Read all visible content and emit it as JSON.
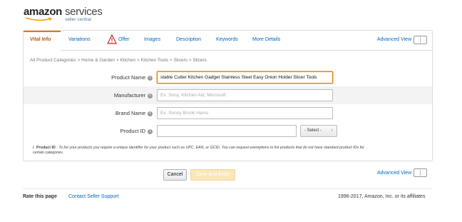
{
  "brand": {
    "name": "amazon",
    "suffix": "services",
    "subtitle": "seller central"
  },
  "tabs": [
    {
      "label": "Vital Info",
      "active": true
    },
    {
      "label": "Variations"
    },
    {
      "label": "Offer",
      "warning": true
    },
    {
      "label": "Images"
    },
    {
      "label": "Description"
    },
    {
      "label": "Keywords"
    },
    {
      "label": "More Details"
    }
  ],
  "advanced_view_label": "Advanced View",
  "breadcrumb": "All Product Categories > Home & Garden > Kitchen > Kitchen Tools > Slicers > Slicers",
  "form": {
    "product_name": {
      "label": "Product Name",
      "value": "stable Cutter Kitchen Gadget Stainless Steel Easy Onion Holder Slicer Tools"
    },
    "manufacturer": {
      "label": "Manufacturer",
      "placeholder": "Ex: Sony, Kitchen Aid, Microsoft"
    },
    "brand_name": {
      "label": "Brand Name",
      "placeholder": "Ex: Sonny Brook Hams"
    },
    "product_id": {
      "label": "Product ID",
      "select": "- Select -"
    }
  },
  "note": {
    "title": "Product ID",
    "text": ": To list your products you require a unique identifier for your product such as UPC, EAN, or GCID. You can request exemptions to list products that do not have standard product IDs for certain categories."
  },
  "buttons": {
    "cancel": "Cancel",
    "save": "Save and finish"
  },
  "footer": {
    "rate": "Rate this page",
    "contact": "Contact Seller Support",
    "copyright": "1996-2017, Amazon, Inc. or its affiliates"
  },
  "colors": {
    "accent": "#e47911",
    "link": "#0066c0",
    "active_tab": "#c45500"
  }
}
